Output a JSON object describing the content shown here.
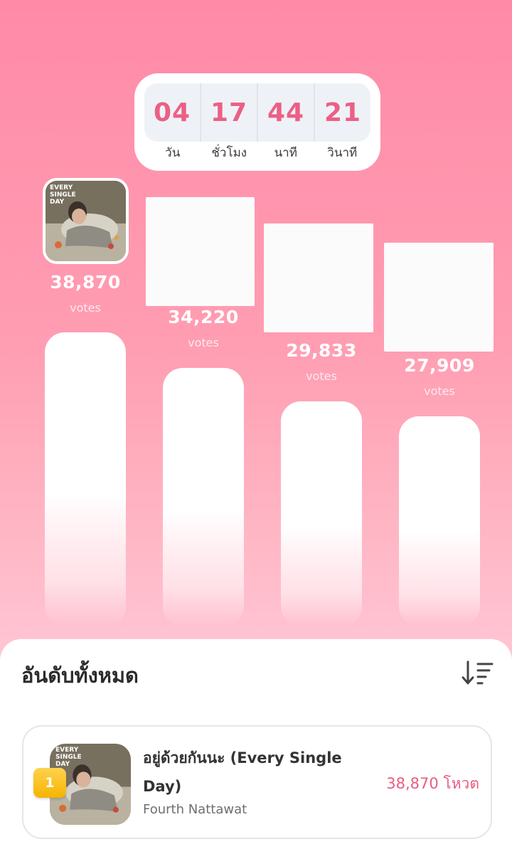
{
  "countdown": {
    "days": "04",
    "hours": "17",
    "minutes": "44",
    "seconds": "21",
    "days_label": "วัน",
    "hours_label": "ชั่วโมง",
    "minutes_label": "นาที",
    "seconds_label": "วินาที"
  },
  "podium": [
    {
      "votes": "38,870",
      "votes_label": "votes",
      "cover_art": "EVERY SINGLE DAY"
    },
    {
      "votes": "34,220",
      "votes_label": "votes"
    },
    {
      "votes": "29,833",
      "votes_label": "votes"
    },
    {
      "votes": "27,909",
      "votes_label": "votes"
    }
  ],
  "ranking": {
    "title": "อันดับทั้งหมด",
    "sort_icon": "sort-descending-icon",
    "items": [
      {
        "rank": "1",
        "song": "อยู่ด้วยกันนะ (Every Single Day)",
        "artist": "Fourth Nattawat",
        "votes": "38,870 โหวต",
        "cover_art": "EVERY SINGLE DAY"
      }
    ]
  },
  "colors": {
    "accent": "#ec5f86",
    "badge_gold": "#f5b400"
  }
}
